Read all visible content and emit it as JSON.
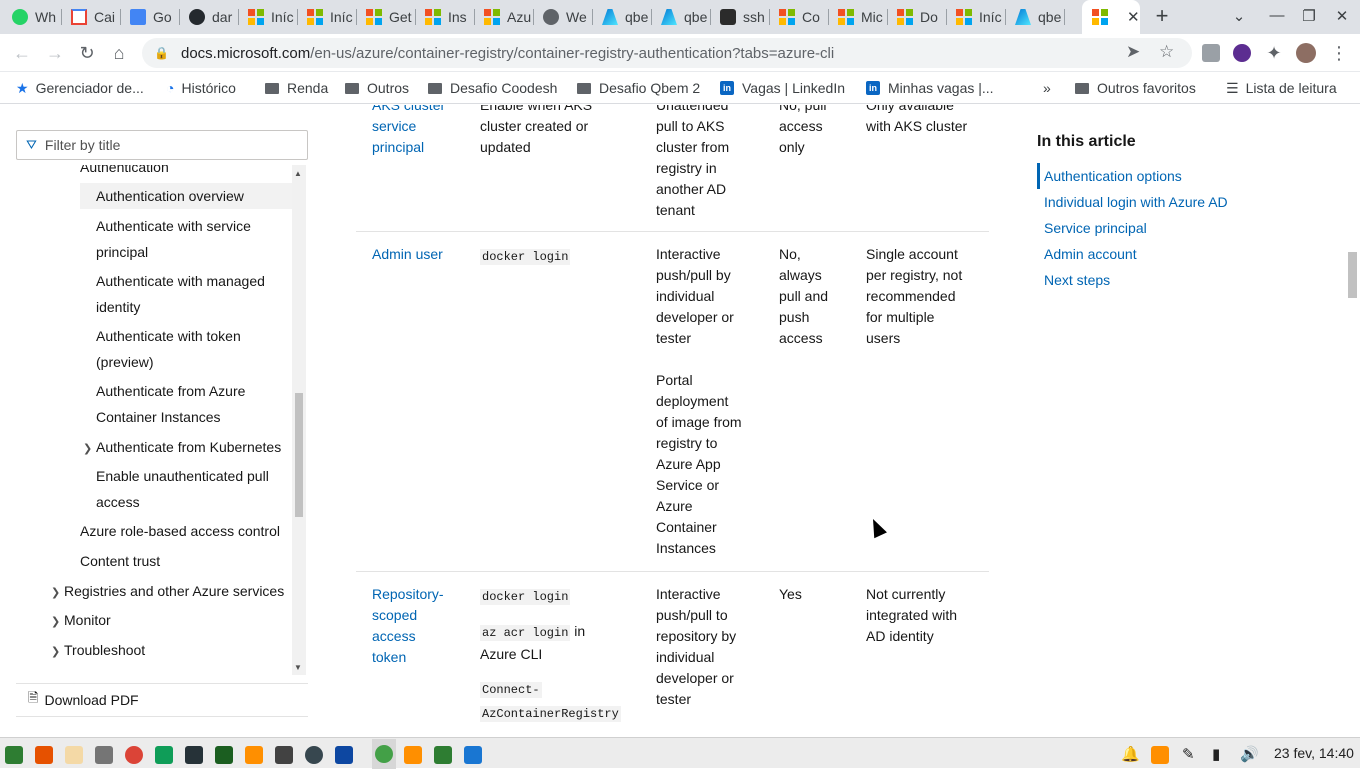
{
  "tabs": [
    {
      "label": "Wh",
      "icon": "whatsapp-icon"
    },
    {
      "label": "Cai",
      "icon": "gmail-icon"
    },
    {
      "label": "Go",
      "icon": "google-calendar-icon"
    },
    {
      "label": "dar",
      "icon": "github-icon"
    },
    {
      "label": "Iníc",
      "icon": "microsoft-icon"
    },
    {
      "label": "Iníc",
      "icon": "microsoft-icon"
    },
    {
      "label": "Get",
      "icon": "microsoft-icon"
    },
    {
      "label": "Ins",
      "icon": "microsoft-icon"
    },
    {
      "label": "Azu",
      "icon": "microsoft-icon"
    },
    {
      "label": "We",
      "icon": "globe-icon"
    },
    {
      "label": "qbe",
      "icon": "azure-icon"
    },
    {
      "label": "qbe",
      "icon": "azure-icon"
    },
    {
      "label": "ssh",
      "icon": "terminal-icon"
    },
    {
      "label": "Co",
      "icon": "microsoft-icon"
    },
    {
      "label": "Mic",
      "icon": "microsoft-icon"
    },
    {
      "label": "Do",
      "icon": "microsoft-icon"
    },
    {
      "label": "Iníc",
      "icon": "microsoft-icon"
    },
    {
      "label": "qbe",
      "icon": "azure-icon"
    }
  ],
  "url": {
    "host": "docs.microsoft.com",
    "path": "/en-us/azure/container-registry/container-registry-authentication?tabs=azure-cli"
  },
  "bookmarks": [
    "Gerenciador de...",
    "Histórico",
    "Renda",
    "Outros",
    "Desafio Coodesh",
    "Desafio Qbem 2",
    "Vagas | LinkedIn",
    "Minhas vagas |...",
    "Outros favoritos",
    "Lista de leitura"
  ],
  "filter_placeholder": "Filter by title",
  "toc": {
    "partial_top": "Authentication",
    "items": [
      "Authentication overview",
      "Authenticate with service principal",
      "Authenticate with managed identity",
      "Authenticate with token (preview)",
      "Authenticate from Azure Container Instances",
      "Authenticate from Kubernetes",
      "Enable unauthenticated pull access",
      "Azure role-based access control",
      "Content trust",
      "Registries and other Azure services",
      "Monitor",
      "Troubleshoot"
    ]
  },
  "download_pdf": "Download PDF",
  "table": {
    "row1": {
      "option": [
        "AKS cluster",
        "service",
        "principal"
      ],
      "howto": [
        "Enable when AKS",
        "cluster created or",
        "updated"
      ],
      "scenarios": [
        "Unattended",
        "pull to AKS",
        "cluster from",
        "registry in",
        "another AD",
        "tenant"
      ],
      "rbac": [
        "No, pull",
        "access",
        "only"
      ],
      "limits": [
        "Only available",
        "with AKS cluster"
      ]
    },
    "row2": {
      "option": "Admin user",
      "howto": "docker login",
      "scenarios1": [
        "Interactive",
        "push/pull by",
        "individual",
        "developer or",
        "tester"
      ],
      "scenarios2": [
        "Portal",
        "deployment",
        "of image from",
        "registry to",
        "Azure App",
        "Service or",
        "Azure",
        "Container",
        "Instances"
      ],
      "rbac": [
        "No,",
        "always",
        "pull and",
        "push",
        "access"
      ],
      "limits": [
        "Single account",
        "per registry, not",
        "recommended",
        "for multiple",
        "users"
      ]
    },
    "row3": {
      "option": [
        "Repository-",
        "scoped",
        "access",
        "token"
      ],
      "code1": "docker login",
      "code2": "az acr login",
      "code2_suffix": " in",
      "code2_line2": "Azure CLI",
      "code3a": "Connect-",
      "code3b": "AzContainerRegistry",
      "scenarios": [
        "Interactive",
        "push/pull to",
        "repository by",
        "individual",
        "developer or",
        "tester"
      ],
      "rbac": "Yes",
      "limits": [
        "Not currently",
        "integrated with",
        "AD identity"
      ]
    }
  },
  "in_this_article": {
    "title": "In this article",
    "links": [
      "Authentication options",
      "Individual login with Azure AD",
      "Service principal",
      "Admin account",
      "Next steps"
    ]
  },
  "clock": "23 fev, 14:40"
}
